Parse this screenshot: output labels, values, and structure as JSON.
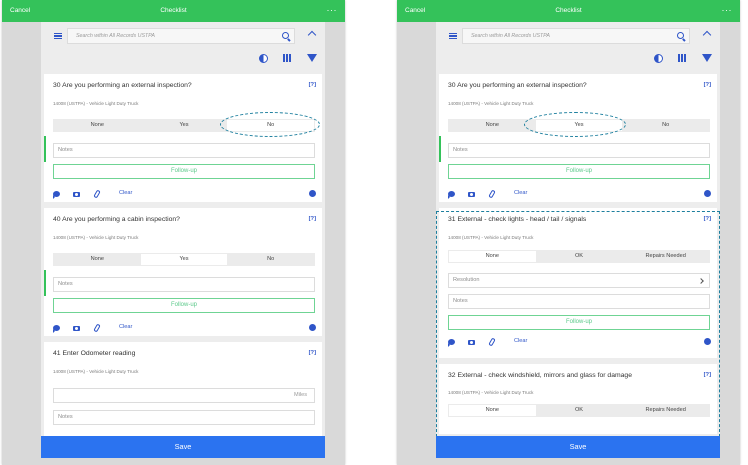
{
  "app": {
    "cancel": "Cancel",
    "title": "Checklist",
    "more": "···",
    "search_placeholder": "Search within All Records USTPA",
    "save": "Save"
  },
  "left": {
    "q30": {
      "title": "30  Are you performing an external inspection?",
      "subtitle": "14008 (USTPA) - Vehicle Light Duty Truck",
      "options": [
        "None",
        "Yes",
        "No"
      ],
      "selected": "No",
      "notes_placeholder": "Notes",
      "followup": "Follow-up",
      "clear": "Clear",
      "help": "[?]"
    },
    "q40": {
      "title": "40  Are you performing a cabin inspection?",
      "subtitle": "14008 (USTPA) - Vehicle Light Duty Truck",
      "options": [
        "None",
        "Yes",
        "No"
      ],
      "selected": "Yes",
      "notes_placeholder": "Notes",
      "followup": "Follow-up",
      "clear": "Clear",
      "help": "[?]"
    },
    "q41": {
      "title": "41  Enter Odometer reading",
      "subtitle": "14008 (USTPA) - Vehicle Light Duty Truck",
      "unit": "Miles",
      "notes_placeholder": "Notes",
      "help": "[?]"
    }
  },
  "right": {
    "q30": {
      "title": "30  Are you performing an external inspection?",
      "subtitle": "14008 (USTPA) - Vehicle Light Duty Truck",
      "options": [
        "None",
        "Yes",
        "No"
      ],
      "selected": "Yes",
      "notes_placeholder": "Notes",
      "followup": "Follow-up",
      "clear": "Clear",
      "help": "[?]"
    },
    "q31": {
      "title": "31  External - check lights - head / tail / signals",
      "subtitle": "14008 (USTPA) - Vehicle Light Duty Truck",
      "options": [
        "None",
        "OK",
        "Repairs Needed"
      ],
      "selected": "None",
      "resolution": "Resolution",
      "notes_placeholder": "Notes",
      "followup": "Follow-up",
      "clear": "Clear",
      "help": "[?]"
    },
    "q32": {
      "title": "32  External - check windshield, mirrors and glass for damage",
      "subtitle": "14008 (USTPA) - Vehicle Light Duty Truck",
      "options": [
        "None",
        "OK",
        "Repairs Needed"
      ],
      "selected": "None",
      "help": "[?]"
    }
  },
  "colors": {
    "header_green": "#34c25a",
    "accent_blue": "#2f55c8",
    "save_blue": "#2b73f0",
    "highlight": "#1d7f9e"
  }
}
